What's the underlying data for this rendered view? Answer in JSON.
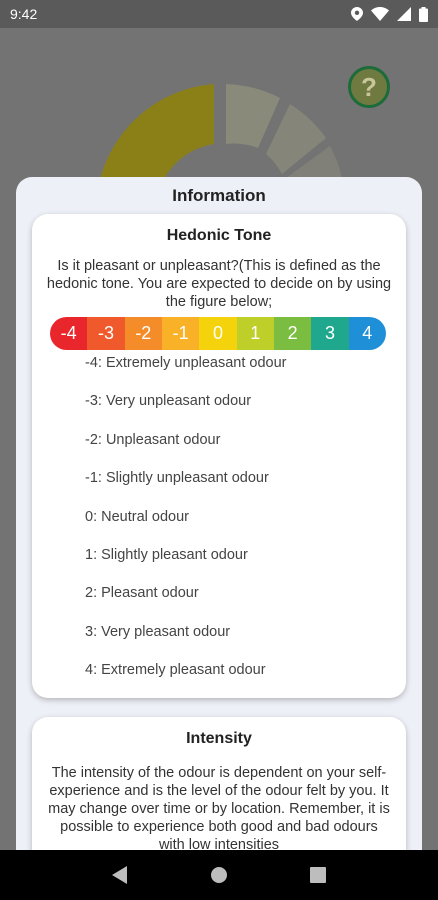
{
  "status": {
    "time": "9:42"
  },
  "background": {
    "help_symbol": "?"
  },
  "dialog": {
    "title": "Information",
    "hedonic": {
      "title": "Hedonic Tone",
      "text": "Is it pleasant or unpleasant?(This is defined as the hedonic tone. You are expected to decide on by using the figure below;",
      "scale": [
        {
          "label": "-4",
          "color": "#e8262b"
        },
        {
          "label": "-3",
          "color": "#f0592b"
        },
        {
          "label": "-2",
          "color": "#f58c2a"
        },
        {
          "label": "-1",
          "color": "#f9b228"
        },
        {
          "label": "0",
          "color": "#f5d30c"
        },
        {
          "label": "1",
          "color": "#bfcf2a"
        },
        {
          "label": "2",
          "color": "#7bbd40"
        },
        {
          "label": "3",
          "color": "#1fa88d"
        },
        {
          "label": "4",
          "color": "#1f90d8"
        }
      ],
      "descriptions": [
        "-4: Extremely unpleasant odour",
        "-3: Very unpleasant odour",
        "-2: Unpleasant odour",
        "-1: Slightly unpleasant odour",
        "0: Neutral odour",
        "1: Slightly pleasant odour",
        "2: Pleasant odour",
        "3: Very pleasant odour",
        "4: Extremely pleasant odour"
      ]
    },
    "intensity": {
      "title": "Intensity",
      "text": "The intensity of the odour is dependent on your self-experience and is the level of the odour felt by you. It may change over time or by location. Remember, it is possible to experience both good and bad odours with low intensities"
    }
  }
}
